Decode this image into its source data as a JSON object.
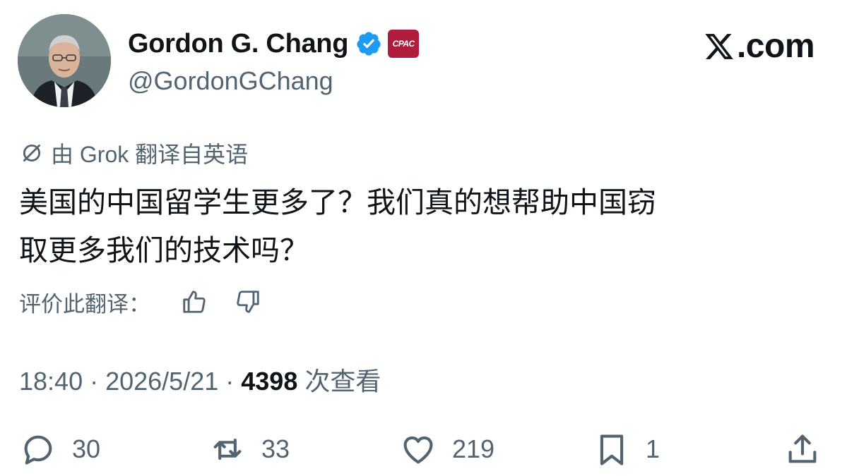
{
  "author": {
    "display_name": "Gordon G. Chang",
    "handle": "@GordonGChang",
    "affiliation_badge": "CPAC",
    "verified_color": "#1d9bf0"
  },
  "brand": {
    "text": ".com",
    "logo_icon": "x-logo-icon"
  },
  "translation": {
    "note": "由 Grok 翻译自英语",
    "icon": "grok-icon"
  },
  "tweet": {
    "lines": [
      "美国的中国留学生更多了？我们真的想帮助中国窃",
      "取更多我们的技术吗？"
    ]
  },
  "rating": {
    "label": "评价此翻译："
  },
  "meta": {
    "time": "18:40",
    "separator": " · ",
    "date": "2026/5/21",
    "views_count": "4398",
    "views_label": " 次查看"
  },
  "actions": {
    "replies": "30",
    "reposts": "33",
    "likes": "219",
    "bookmarks": "1"
  },
  "colors": {
    "text": "#0f1419",
    "secondary": "#536471",
    "accent": "#1d9bf0",
    "cpac": "#b01c3c"
  }
}
